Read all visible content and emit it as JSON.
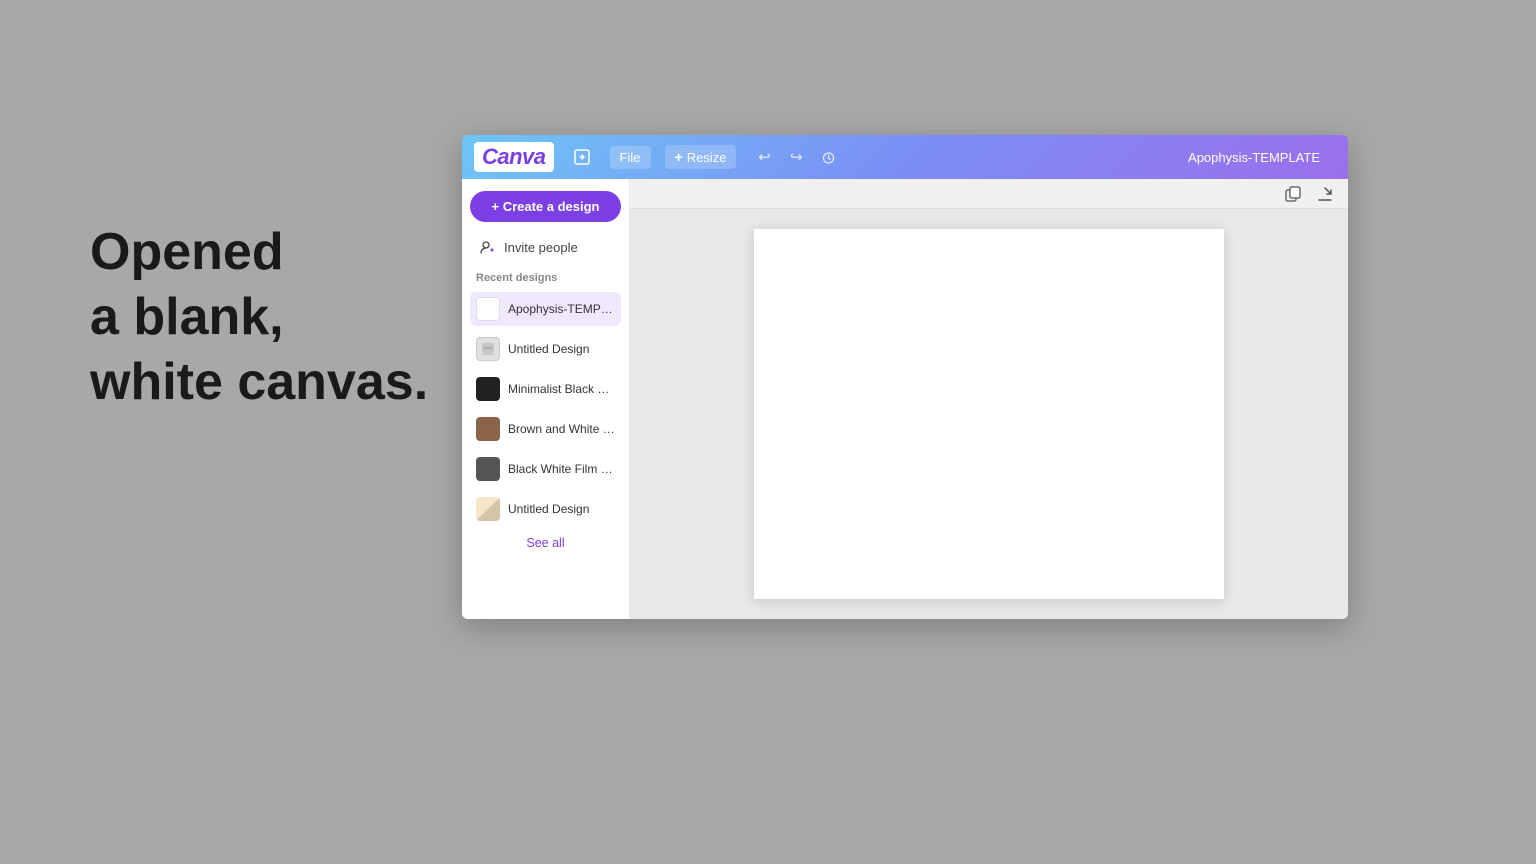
{
  "background": {
    "color": "#a8a8a8"
  },
  "annotation": {
    "line1": "Opened",
    "line2": "a blank,",
    "line3": "white canvas."
  },
  "canva": {
    "logo": "Canva",
    "topbar": {
      "file_label": "File",
      "resize_label": "Resize",
      "title": "Apophysis-TEMPLATE",
      "share_icon": "share",
      "export_icon": "export",
      "undo_icon": "↩",
      "redo_icon": "↪",
      "timer_icon": "⏱"
    },
    "sidebar": {
      "create_btn_label": "+ Create a design",
      "invite_btn_label": "Invite people",
      "recent_label": "Recent designs",
      "see_all_label": "See all",
      "recent_items": [
        {
          "name": "Apophysis-TEMPLATE",
          "thumb": "white",
          "active": true
        },
        {
          "name": "Untitled Design",
          "thumb": "gray",
          "active": false
        },
        {
          "name": "Minimalist Black Whit...",
          "thumb": "dark",
          "active": false
        },
        {
          "name": "Brown and White Pho...",
          "thumb": "brown",
          "active": false
        },
        {
          "name": "Black White Film Fram...",
          "thumb": "film",
          "active": false
        },
        {
          "name": "Untitled Design",
          "thumb": "multi",
          "active": false
        }
      ]
    },
    "canvas": {
      "copy_icon": "⧉",
      "share_icon": "↗"
    }
  }
}
